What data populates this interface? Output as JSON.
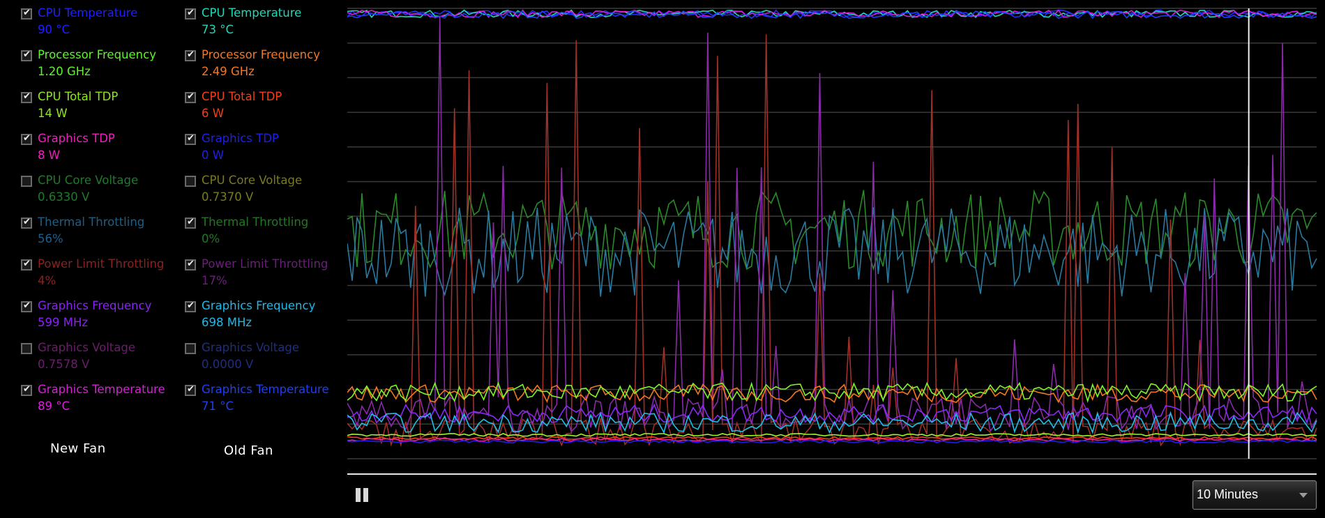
{
  "panels": [
    {
      "name": "New Fan",
      "metrics": [
        {
          "label": "CPU Temperature",
          "value": "90 °C",
          "checked": true,
          "color": "#1f1fff"
        },
        {
          "label": "Processor Frequency",
          "value": "1.20 GHz",
          "checked": true,
          "color": "#5cf52a"
        },
        {
          "label": "CPU Total TDP",
          "value": "14 W",
          "checked": true,
          "color": "#8ee81b"
        },
        {
          "label": "Graphics TDP",
          "value": "8 W",
          "checked": true,
          "color": "#f01fbe"
        },
        {
          "label": "CPU Core Voltage",
          "value": "0.6330 V",
          "checked": false,
          "color": "#1f7a2c"
        },
        {
          "label": "Thermal Throttling",
          "value": "56%",
          "checked": true,
          "color": "#1f5f86"
        },
        {
          "label": "Power Limit Throttling",
          "value": "4%",
          "checked": true,
          "color": "#8a2222"
        },
        {
          "label": "Graphics Frequency",
          "value": "599 MHz",
          "checked": true,
          "color": "#8a22f5"
        },
        {
          "label": "Graphics Voltage",
          "value": "0.7578 V",
          "checked": false,
          "color": "#6b1e6b"
        },
        {
          "label": "Graphics Temperature",
          "value": "89 °C",
          "checked": true,
          "color": "#d81fd8"
        }
      ]
    },
    {
      "name": "Old Fan",
      "metrics": [
        {
          "label": "CPU Temperature",
          "value": "73 °C",
          "checked": true,
          "color": "#1fd8b8"
        },
        {
          "label": "Processor Frequency",
          "value": "2.49 GHz",
          "checked": true,
          "color": "#f5781f"
        },
        {
          "label": "CPU Total TDP",
          "value": "6 W",
          "checked": true,
          "color": "#f0401a"
        },
        {
          "label": "Graphics TDP",
          "value": "0 W",
          "checked": true,
          "color": "#1f1fe8"
        },
        {
          "label": "CPU Core Voltage",
          "value": "0.7370 V",
          "checked": false,
          "color": "#7a7a1f"
        },
        {
          "label": "Thermal Throttling",
          "value": "0%",
          "checked": true,
          "color": "#1f7a1f"
        },
        {
          "label": "Power Limit Throttling",
          "value": "17%",
          "checked": true,
          "color": "#6a1f7a"
        },
        {
          "label": "Graphics Frequency",
          "value": "698 MHz",
          "checked": true,
          "color": "#1fb8e8"
        },
        {
          "label": "Graphics Voltage",
          "value": "0.0000 V",
          "checked": false,
          "color": "#1f2f7a"
        },
        {
          "label": "Graphics Temperature",
          "value": "71 °C",
          "checked": true,
          "color": "#1f3ff0"
        }
      ]
    }
  ],
  "controls": {
    "pause_icon": "pause-icon",
    "time_range": "10 Minutes"
  },
  "chart_data": {
    "type": "line",
    "title": "",
    "xlabel": "",
    "ylabel": "",
    "ylim": [
      0,
      100
    ],
    "grid": true,
    "gridlines": 11,
    "cursor_x_fraction": 0.93,
    "samples": 200,
    "series": [
      {
        "name": "CPU Temperature (New Fan)",
        "color": "#2a2aff",
        "base": 98.8,
        "noise": 0.8,
        "spike": 0
      },
      {
        "name": "CPU Temperature (Old Fan)",
        "color": "#1fd8b8",
        "base": 98.8,
        "noise": 0.8,
        "spike": 0
      },
      {
        "name": "Graphics Temperature (New Fan)",
        "color": "#d81fd8",
        "base": 98.8,
        "noise": 0.8,
        "spike": 0
      },
      {
        "name": "Graphics Temperature (Old Fan)",
        "color": "#1f3ff0",
        "base": 98.6,
        "noise": 0.8,
        "spike": 0
      },
      {
        "name": "Thermal Throttling (Old Fan)",
        "color": "#2a8a2a",
        "base": 51,
        "noise": 9,
        "spike": 0
      },
      {
        "name": "Thermal Throttling (New Fan)",
        "color": "#2a7aa0",
        "base": 46,
        "noise": 10,
        "spike": 0
      },
      {
        "name": "Power Limit Throttling (New Fan)",
        "color": "#a03028",
        "base": 6,
        "noise": 3,
        "spike": 0.12
      },
      {
        "name": "Power Limit Throttling (Old Fan)",
        "color": "#8a2aa8",
        "base": 10,
        "noise": 4,
        "spike": 0.1
      },
      {
        "name": "Processor Frequency (Old Fan)",
        "color": "#f5781f",
        "base": 14.5,
        "noise": 2,
        "spike": 0
      },
      {
        "name": "Processor Frequency (New Fan)",
        "color": "#7ef52a",
        "base": 14.8,
        "noise": 2,
        "spike": 0
      },
      {
        "name": "Graphics Frequency (New Fan)",
        "color": "#8a2af5",
        "base": 10,
        "noise": 2,
        "spike": 0
      },
      {
        "name": "Graphics Frequency (Old Fan)",
        "color": "#1fc0e8",
        "base": 8,
        "noise": 2.2,
        "spike": 0
      },
      {
        "name": "CPU Total TDP (New Fan)",
        "color": "#9ef52a",
        "base": 5.3,
        "noise": 0.3,
        "spike": 0
      },
      {
        "name": "CPU Total TDP (Old Fan)",
        "color": "#f0401a",
        "base": 4.6,
        "noise": 0.3,
        "spike": 0
      },
      {
        "name": "Graphics TDP (New Fan)",
        "color": "#f01fa0",
        "base": 4.2,
        "noise": 0.3,
        "spike": 0
      },
      {
        "name": "Graphics TDP (Old Fan)",
        "color": "#1f1fe8",
        "base": 3.8,
        "noise": 0.3,
        "spike": 0
      }
    ]
  }
}
